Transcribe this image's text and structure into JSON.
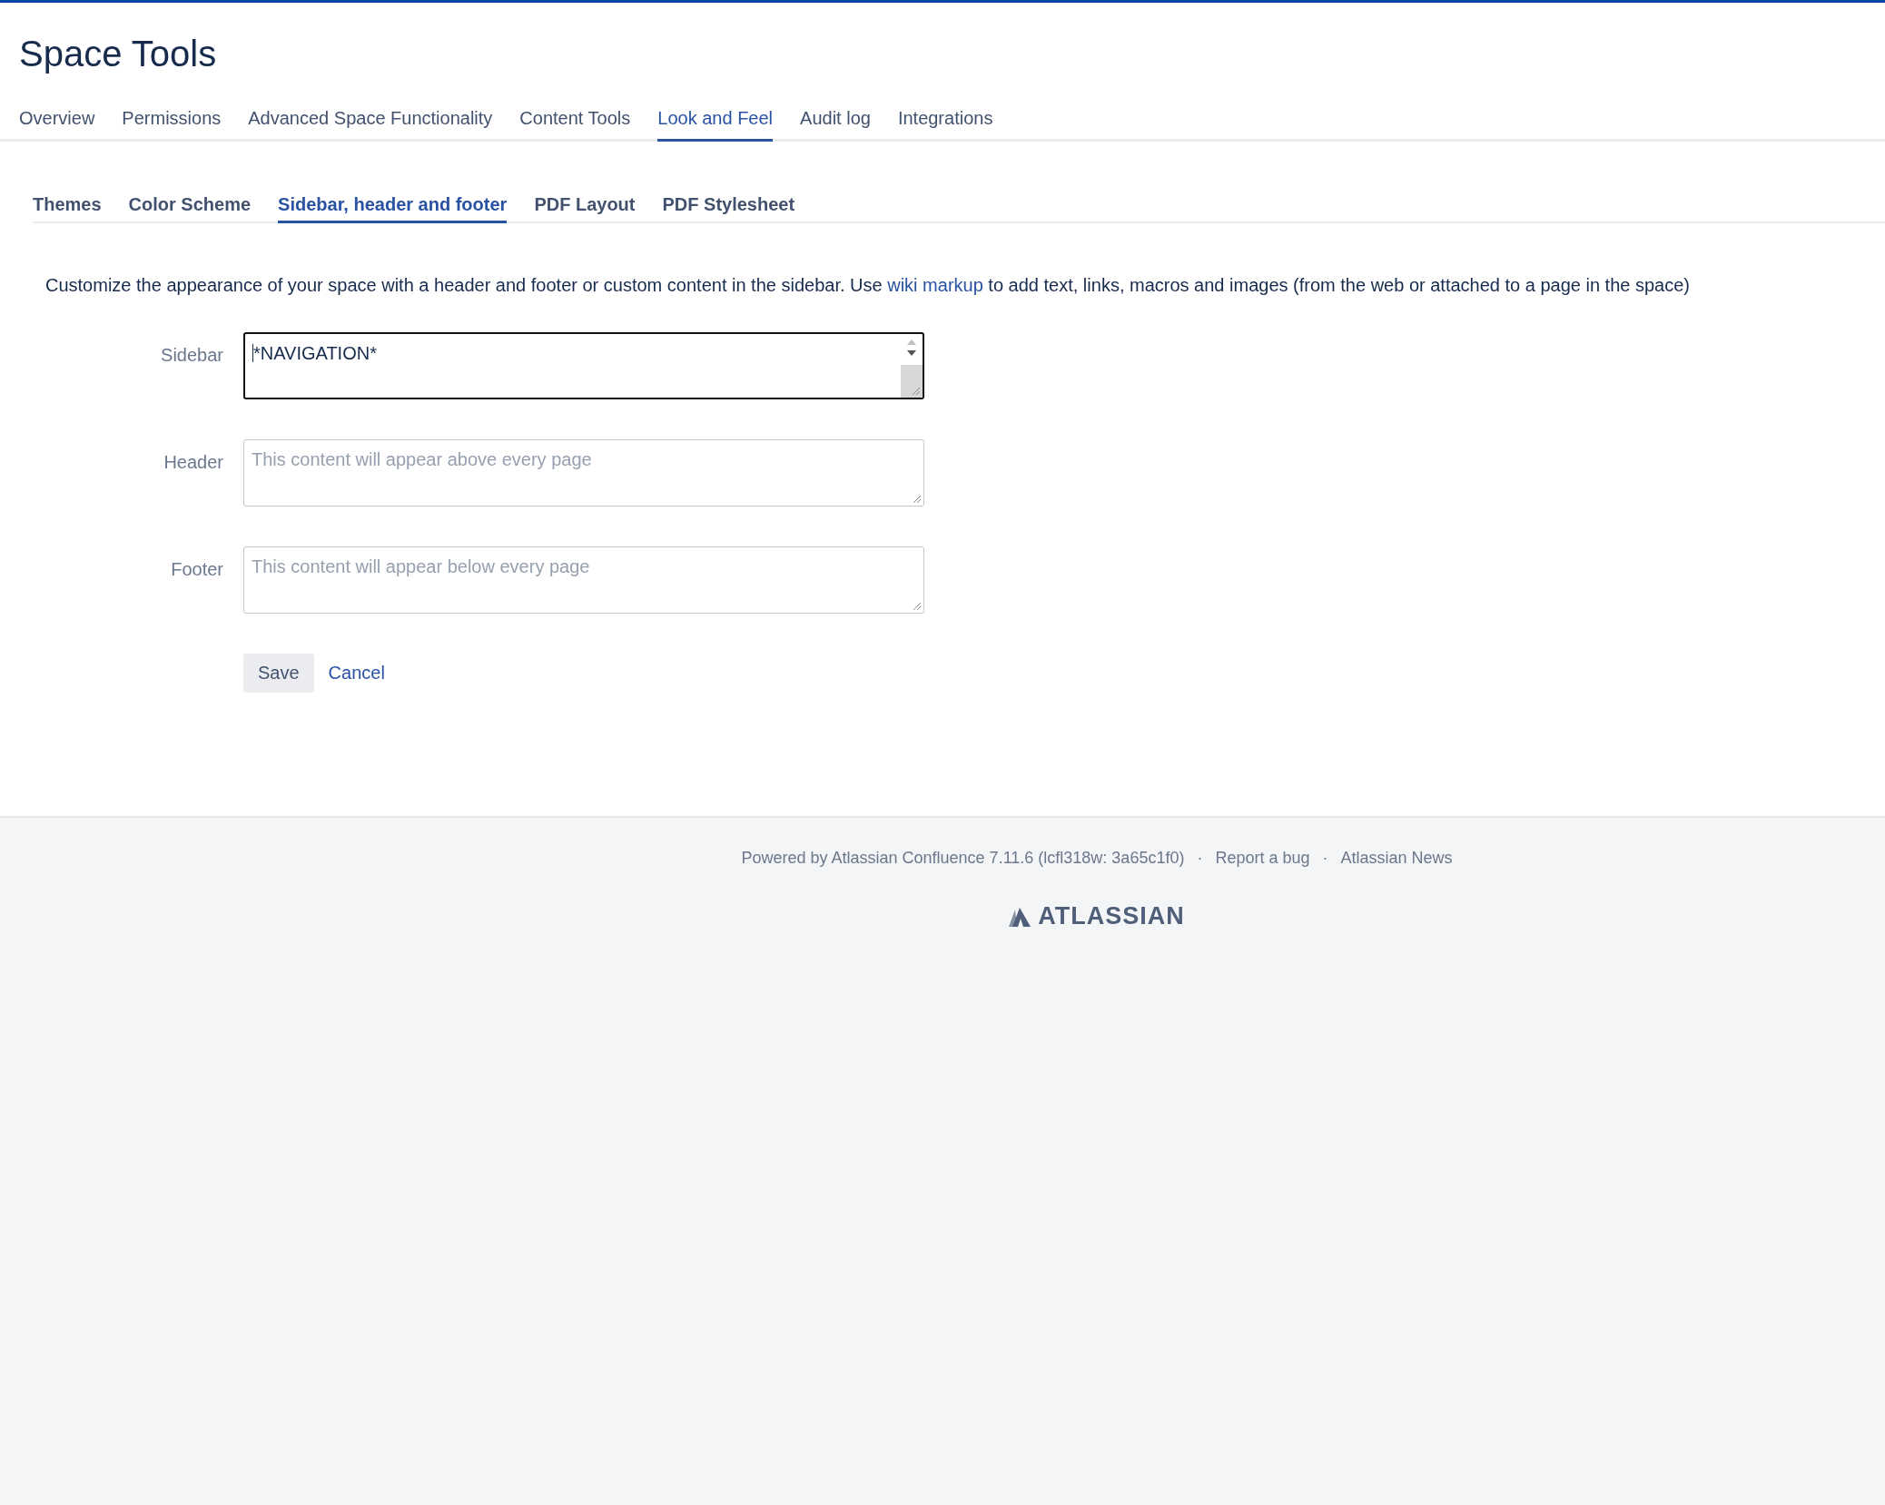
{
  "page_title": "Space Tools",
  "tabs": [
    {
      "label": "Overview",
      "selected": false
    },
    {
      "label": "Permissions",
      "selected": false
    },
    {
      "label": "Advanced Space Functionality",
      "selected": false
    },
    {
      "label": "Content Tools",
      "selected": false
    },
    {
      "label": "Look and Feel",
      "selected": true
    },
    {
      "label": "Audit log",
      "selected": false
    },
    {
      "label": "Integrations",
      "selected": false
    }
  ],
  "subtabs": [
    {
      "label": "Themes",
      "selected": false
    },
    {
      "label": "Color Scheme",
      "selected": false
    },
    {
      "label": "Sidebar, header and footer",
      "selected": true
    },
    {
      "label": "PDF Layout",
      "selected": false
    },
    {
      "label": "PDF Stylesheet",
      "selected": false
    }
  ],
  "description": {
    "before": "Customize the appearance of your space with a header and footer or custom content in the sidebar. Use",
    "link": "wiki markup",
    "after": "to add text, links, macros and images (from the web or attached to a page in the space)"
  },
  "fields": [
    {
      "label": "Sidebar",
      "value": "*NAVIGATION*",
      "focused": true
    },
    {
      "label": "Header",
      "placeholder": "This content will appear above every page",
      "focused": false
    },
    {
      "label": "Footer",
      "placeholder": "This content will appear below every page",
      "focused": false
    }
  ],
  "buttons": {
    "save": "Save",
    "cancel": "Cancel"
  },
  "footer": {
    "powered_by": "Powered by Atlassian Confluence 7.11.6 (lcfl318w: 3a65c1f0)",
    "separator": "·",
    "links": [
      "Report a bug",
      "Atlassian News"
    ],
    "logo_text": "ATLASSIAN"
  }
}
